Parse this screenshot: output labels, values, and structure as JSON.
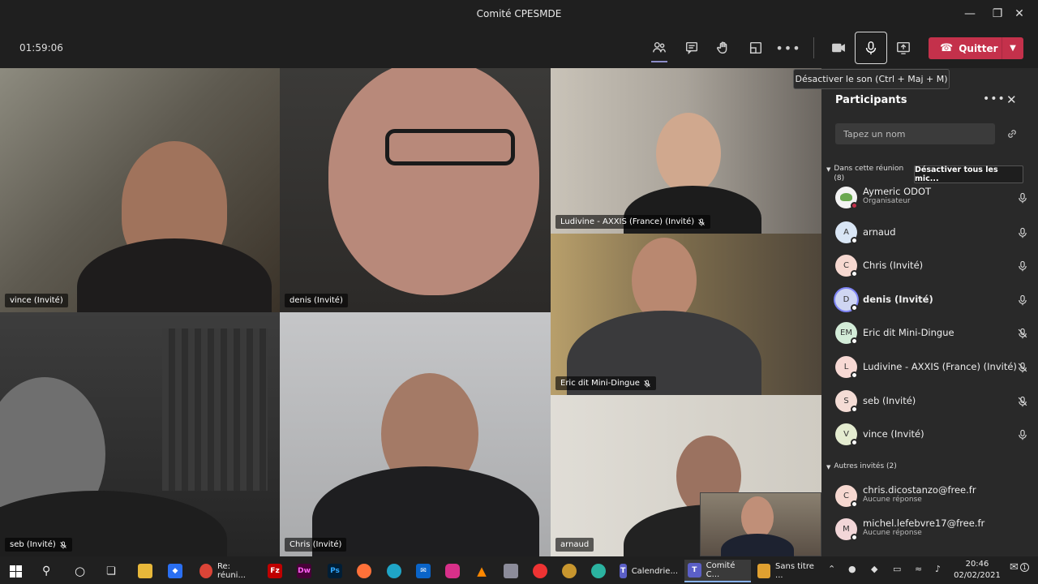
{
  "window": {
    "title": "Comité CPESMDE"
  },
  "toolbar": {
    "timer": "01:59:06",
    "quit_label": "Quitter",
    "tooltip": "Désactiver le son (Ctrl + Maj + M)"
  },
  "tiles": [
    {
      "name": "vince (Invité)",
      "muted": false
    },
    {
      "name": "denis (Invité)",
      "muted": false
    },
    {
      "name": "Ludivine - AXXIS (France) (Invité)",
      "muted": true
    },
    {
      "name": "Eric dit Mini-Dingue",
      "muted": true
    },
    {
      "name": "seb (Invité)",
      "muted": true
    },
    {
      "name": "Chris (Invité)",
      "muted": false
    },
    {
      "name": "arnaud",
      "muted": false
    }
  ],
  "panel": {
    "title": "Participants",
    "search_placeholder": "Tapez un nom",
    "in_meeting_label": "Dans cette réunion",
    "in_meeting_count": "(8)",
    "mute_all_label": "Désactiver tous les mic...",
    "participants": [
      {
        "initials": "",
        "name": "Aymeric ODOT",
        "role": "Organisateur",
        "avatar_color": "#f3f3f3",
        "muted": false
      },
      {
        "initials": "A",
        "name": "arnaud",
        "role": "",
        "avatar_color": "#d9e6f5",
        "muted": false
      },
      {
        "initials": "C",
        "name": "Chris (Invité)",
        "role": "",
        "avatar_color": "#f6d8d0",
        "muted": false
      },
      {
        "initials": "D",
        "name": "denis (Invité)",
        "role": "",
        "avatar_color": "#cfd6f2",
        "muted": false
      },
      {
        "initials": "EM",
        "name": "Eric dit Mini-Dingue",
        "role": "",
        "avatar_color": "#d3ecd8",
        "muted": true
      },
      {
        "initials": "L",
        "name": "Ludivine - AXXIS (France) (Invité)",
        "role": "",
        "avatar_color": "#f7d9d4",
        "muted": true
      },
      {
        "initials": "S",
        "name": "seb (Invité)",
        "role": "",
        "avatar_color": "#f4dcd5",
        "muted": true
      },
      {
        "initials": "V",
        "name": "vince (Invité)",
        "role": "",
        "avatar_color": "#e4ecd0",
        "muted": false
      }
    ],
    "others_label": "Autres invités (2)",
    "others": [
      {
        "initials": "C",
        "name": "chris.dicostanzo@free.fr",
        "status": "Aucune réponse",
        "avatar_color": "#f6d8d0"
      },
      {
        "initials": "M",
        "name": "michel.lefebvre17@free.fr",
        "status": "Aucune réponse",
        "avatar_color": "#f2d6d8"
      }
    ]
  },
  "taskbar": {
    "items": [
      {
        "label": "Re: réuni...",
        "icon": "chrome-icon",
        "color": "#db4437"
      },
      {
        "label": "Calendrie...",
        "icon": "teams-icon",
        "color": "#5b5fc7"
      },
      {
        "label": "Comité C...",
        "icon": "teams-icon",
        "color": "#5b5fc7"
      },
      {
        "label": "Sans titre ...",
        "icon": "paint-icon",
        "color": "#e0a030"
      }
    ],
    "time": "20:46",
    "date": "02/02/2021",
    "notification_count": "1"
  }
}
